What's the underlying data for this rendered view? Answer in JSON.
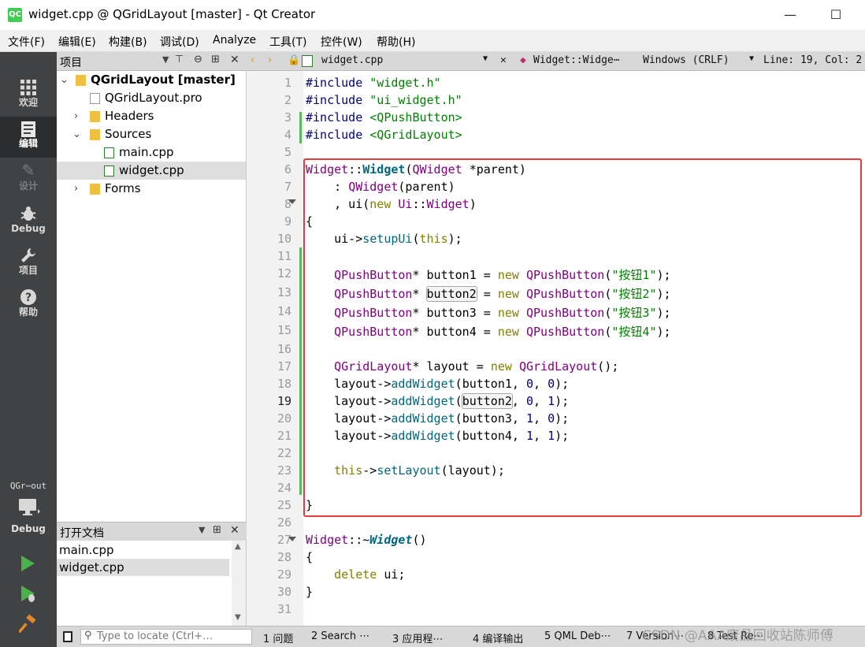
{
  "window": {
    "title": "widget.cpp @ QGridLayout [master] - Qt Creator",
    "app_icon_text": "QC",
    "minimize": "—",
    "maximize": "☐"
  },
  "menu": [
    "文件(F)",
    "编辑(E)",
    "构建(B)",
    "调试(D)",
    "Analyze",
    "工具(T)",
    "控件(W)",
    "帮助(H)"
  ],
  "modes": [
    {
      "label": "欢迎",
      "icon": "grid-icon"
    },
    {
      "label": "编辑",
      "icon": "edit-icon"
    },
    {
      "label": "设计",
      "icon": "pencil-icon"
    },
    {
      "label": "Debug",
      "icon": "bug-icon"
    },
    {
      "label": "项目",
      "icon": "wrench-icon"
    },
    {
      "label": "帮助",
      "icon": "help-icon"
    }
  ],
  "kit": {
    "name": "QGr⋯out",
    "mode": "Debug"
  },
  "project_pane": {
    "title": "项目",
    "tree": [
      {
        "label": "QGridLayout [master]",
        "bold": true
      },
      {
        "label": "QGridLayout.pro"
      },
      {
        "label": "Headers"
      },
      {
        "label": "Sources"
      },
      {
        "label": "main.cpp"
      },
      {
        "label": "widget.cpp",
        "selected": true
      },
      {
        "label": "Forms"
      }
    ]
  },
  "open_docs": {
    "title": "打开文档",
    "items": [
      "main.cpp",
      "widget.cpp"
    ]
  },
  "editor_toolbar": {
    "file": "widget.cpp",
    "symbol": "Widget::Widge⋯",
    "line_ending": "Windows (CRLF)",
    "position": "Line: 19, Col: 2"
  },
  "code": {
    "line_numbers": [
      "1",
      "2",
      "3",
      "4",
      "5",
      "6",
      "7",
      "8",
      "9",
      "10",
      "11",
      "12",
      "13",
      "14",
      "15",
      "16",
      "17",
      "18",
      "19",
      "20",
      "21",
      "22",
      "23",
      "24",
      "25",
      "26",
      "27",
      "28",
      "29",
      "30",
      "31"
    ],
    "current_line": "19",
    "tokens": {
      "include": "#include",
      "h1": "\"widget.h\"",
      "h2": "\"ui_widget.h\"",
      "h3": "<QPushButton>",
      "h4": "<QGridLayout>",
      "widget": "Widget",
      "scope": "::",
      "ctor": "Widget",
      "qwidget": "QWidget",
      "parent_param": " *parent)",
      "l7_pre": "    : ",
      "l7_post": "(parent)",
      "l8_pre": "    , ui(",
      "new": "new",
      "ui_ns": "Ui",
      "l8_end": ")",
      "lbrace": "{",
      "rbrace": "}",
      "l10_pre": "    ui->",
      "setupUi": "setupUi",
      "paren_open": "(",
      "this": "this",
      "l10_end": ");",
      "indent": "    ",
      "qpushbutton": "QPushButton",
      "star": "*",
      "button1": "button1",
      "button2": "button2",
      "button3": "button3",
      "button4": "button4",
      "eq": " = ",
      "s1": "\"按钮1\"",
      "s2": "\"按钮2\"",
      "s3": "\"按钮3\"",
      "s4": "\"按钮4\"",
      "end": ");",
      "qgridlayout": "QGridLayout",
      "layout_decl": " layout = ",
      "l17_end": "();",
      "layout_arrow": "    layout->",
      "addWidget": "addWidget",
      "comma": ", ",
      "zero": "0",
      "one": "1",
      "setLayout": "setLayout",
      "arrow": "->",
      "layout_arg": "(layout);",
      "dtor_tilde": "::~",
      "dtor": "Widget",
      "parens": "()",
      "delete": "delete",
      "ui_semi": " ui;"
    }
  },
  "statusbar": {
    "locator_placeholder": "Type to locate (Ctrl+…",
    "tabs": [
      "1 问题",
      "2 Search ⋯",
      "3 应用程⋯",
      "4 编译输出",
      "5 QML Deb⋯",
      "7 Version⋯",
      "8 Test Re⋯"
    ]
  },
  "watermark": "CSDN @AAA废品回收站陈师傅",
  "colors": {
    "highlight_box": "#e23c3c",
    "change_marker": "#5cb85c",
    "modebar": "#404244"
  }
}
